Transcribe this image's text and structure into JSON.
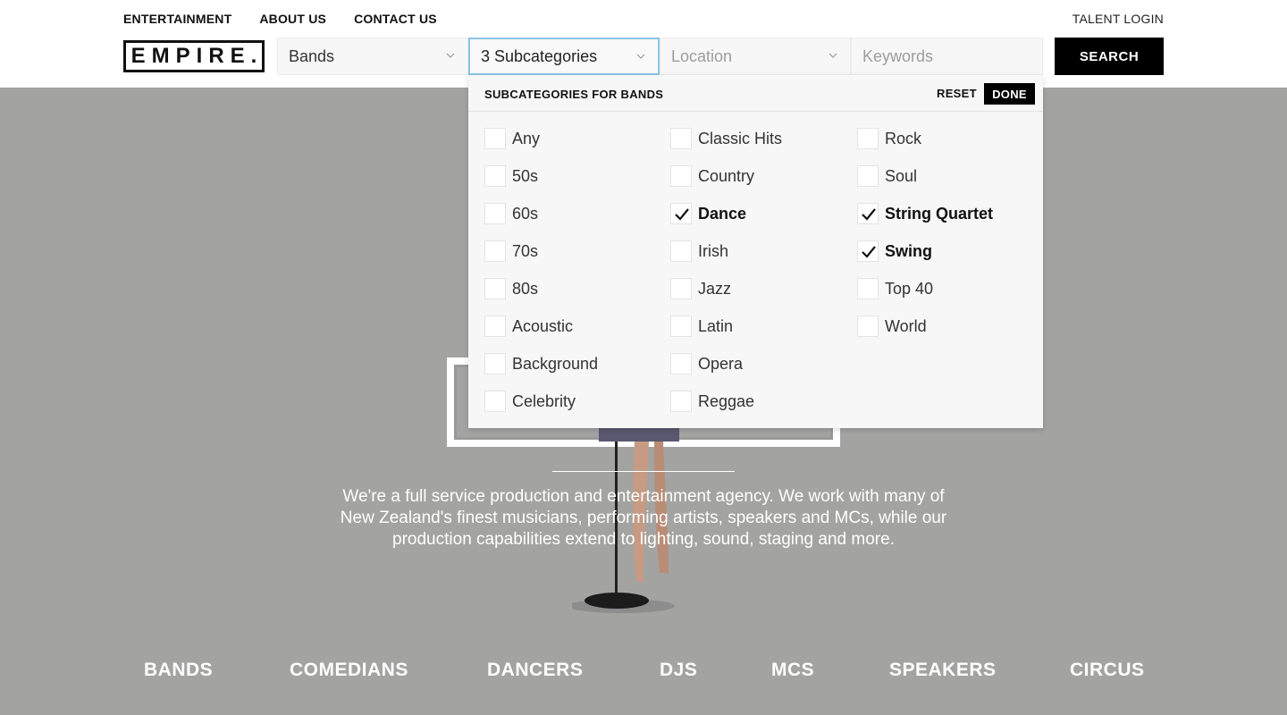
{
  "nav": {
    "items": [
      "ENTERTAINMENT",
      "ABOUT US",
      "CONTACT US"
    ],
    "talent_login": "TALENT LOGIN"
  },
  "logo": {
    "text": "EMPIRE."
  },
  "search": {
    "category_value": "Bands",
    "subcategory_value": "3 Subcategories",
    "location_placeholder": "Location",
    "keywords_placeholder": "Keywords",
    "search_label": "SEARCH"
  },
  "dropdown": {
    "title": "SUBCATEGORIES FOR BANDS",
    "reset_label": "RESET",
    "done_label": "DONE",
    "columns": [
      [
        {
          "label": "Any",
          "checked": false
        },
        {
          "label": "50s",
          "checked": false
        },
        {
          "label": "60s",
          "checked": false
        },
        {
          "label": "70s",
          "checked": false
        },
        {
          "label": "80s",
          "checked": false
        },
        {
          "label": "Acoustic",
          "checked": false
        },
        {
          "label": "Background",
          "checked": false
        },
        {
          "label": "Celebrity",
          "checked": false
        }
      ],
      [
        {
          "label": "Classic Hits",
          "checked": false
        },
        {
          "label": "Country",
          "checked": false
        },
        {
          "label": "Dance",
          "checked": true
        },
        {
          "label": "Irish",
          "checked": false
        },
        {
          "label": "Jazz",
          "checked": false
        },
        {
          "label": "Latin",
          "checked": false
        },
        {
          "label": "Opera",
          "checked": false
        },
        {
          "label": "Reggae",
          "checked": false
        }
      ],
      [
        {
          "label": "Rock",
          "checked": false
        },
        {
          "label": "Soul",
          "checked": false
        },
        {
          "label": "String Quartet",
          "checked": true
        },
        {
          "label": "Swing",
          "checked": true
        },
        {
          "label": "Top 40",
          "checked": false
        },
        {
          "label": "World",
          "checked": false
        }
      ]
    ]
  },
  "hero": {
    "text": "We're a full service production and entertainment agency. We work with many of New Zealand's finest musicians, performing artists, speakers and MCs, while our production capabilities extend to lighting, sound, staging and more."
  },
  "categories": [
    "BANDS",
    "COMEDIANS",
    "DANCERS",
    "DJS",
    "MCS",
    "SPEAKERS",
    "CIRCUS"
  ],
  "colors": {
    "background": "#a3a3a2",
    "header": "#ffffff",
    "accent_focus": "#8cc4e8",
    "button": "#000000"
  }
}
